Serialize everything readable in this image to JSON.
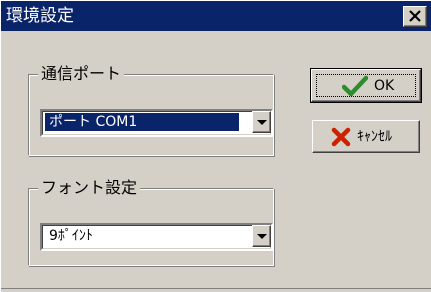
{
  "window": {
    "title": "環境設定",
    "close_label": "✕"
  },
  "port_group": {
    "label": "通信ポート",
    "selected_value": "ポート COM1"
  },
  "font_group": {
    "label": "フォント設定",
    "selected_value": "9ﾎﾟｲﾝﾄ"
  },
  "buttons": {
    "ok_label": "OK",
    "cancel_label": "ｷｬﾝｾﾙ"
  },
  "icons": {
    "ok_icon": "checkmark-icon",
    "cancel_icon": "x-cross-icon"
  },
  "colors": {
    "titlebar": "#0a246a",
    "face": "#d4d0c8",
    "ok_check": "#2e8b2e",
    "cancel_x": "#cc2200"
  }
}
